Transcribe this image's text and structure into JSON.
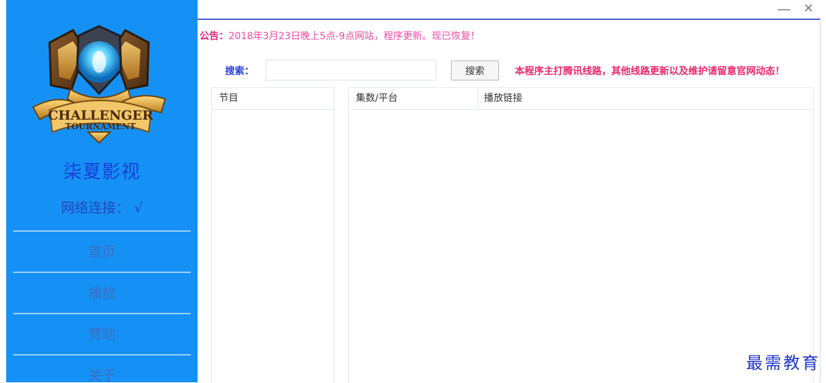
{
  "sidebar": {
    "logo_text_top": "CHALLENGER",
    "logo_text_bottom": "TOURNAMENT",
    "app_name": "柒夏影视",
    "network_status": "网络连接： √",
    "nav_items": [
      {
        "label": "首页"
      },
      {
        "label": "播放"
      },
      {
        "label": "赞助"
      },
      {
        "label": "关于"
      }
    ]
  },
  "window_controls": {
    "minimize": "—",
    "close": "✕"
  },
  "notice": {
    "label": "公告：",
    "text": "2018年3月23日晚上5点-9点网站，程序更新。现已恢复！"
  },
  "search": {
    "label": "搜索：",
    "value": "",
    "button_label": "搜索",
    "warning": "本程序主打腾讯线路，其他线路更新以及维护请留意官网动态！"
  },
  "programs_table": {
    "header": "节目",
    "rows": []
  },
  "episodes_table": {
    "columns": [
      "集数/平台",
      "播放链接"
    ],
    "rows": []
  },
  "watermark": "最需教育",
  "colors": {
    "sidebar_bg": "#1591f5",
    "app_name": "#1a3fd6",
    "notice_label": "#e0247a",
    "notice_text": "#f04aa0",
    "search_label": "#2b3fe0",
    "warning": "#f0286a"
  }
}
